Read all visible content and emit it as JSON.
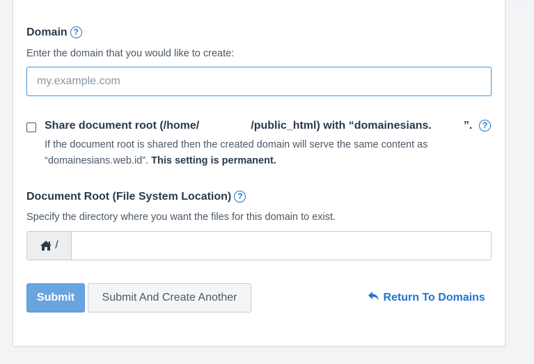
{
  "domain": {
    "label": "Domain",
    "help_icon": "?",
    "description": "Enter the domain that you would like to create:",
    "input_value": "",
    "input_placeholder": "my.example.com"
  },
  "share": {
    "label_part1": "Share document root (/home/",
    "label_part2": "/public_html) with “domainesians.",
    "label_part3": "”.",
    "help_icon": "?",
    "description_line1": "If the document root is shared then the created domain will serve the same content as",
    "description_line2_prefix": "“domainesians.web.id”.",
    "description_line2_bold": "This setting is permanent.",
    "checked": false
  },
  "docroot": {
    "label": "Document Root (File System Location)",
    "help_icon": "?",
    "description": "Specify the directory where you want the files for this domain to exist.",
    "prefix_text": "/",
    "input_value": ""
  },
  "actions": {
    "submit_label": "Submit",
    "submit_another_label": "Submit And Create Another",
    "return_label": "Return To Domains"
  },
  "colors": {
    "primary": "#1f75cc",
    "submit_bg": "#68a4e0"
  }
}
